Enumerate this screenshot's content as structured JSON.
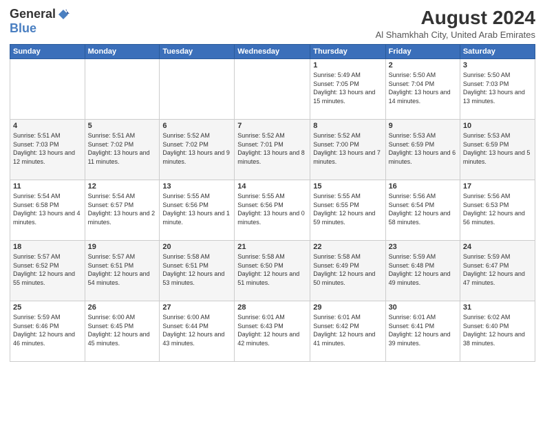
{
  "logo": {
    "general": "General",
    "blue": "Blue"
  },
  "title": "August 2024",
  "subtitle": "Al Shamkhah City, United Arab Emirates",
  "header_days": [
    "Sunday",
    "Monday",
    "Tuesday",
    "Wednesday",
    "Thursday",
    "Friday",
    "Saturday"
  ],
  "weeks": [
    [
      {
        "day": "",
        "info": ""
      },
      {
        "day": "",
        "info": ""
      },
      {
        "day": "",
        "info": ""
      },
      {
        "day": "",
        "info": ""
      },
      {
        "day": "1",
        "info": "Sunrise: 5:49 AM\nSunset: 7:05 PM\nDaylight: 13 hours\nand 15 minutes."
      },
      {
        "day": "2",
        "info": "Sunrise: 5:50 AM\nSunset: 7:04 PM\nDaylight: 13 hours\nand 14 minutes."
      },
      {
        "day": "3",
        "info": "Sunrise: 5:50 AM\nSunset: 7:03 PM\nDaylight: 13 hours\nand 13 minutes."
      }
    ],
    [
      {
        "day": "4",
        "info": "Sunrise: 5:51 AM\nSunset: 7:03 PM\nDaylight: 13 hours\nand 12 minutes."
      },
      {
        "day": "5",
        "info": "Sunrise: 5:51 AM\nSunset: 7:02 PM\nDaylight: 13 hours\nand 11 minutes."
      },
      {
        "day": "6",
        "info": "Sunrise: 5:52 AM\nSunset: 7:02 PM\nDaylight: 13 hours\nand 9 minutes."
      },
      {
        "day": "7",
        "info": "Sunrise: 5:52 AM\nSunset: 7:01 PM\nDaylight: 13 hours\nand 8 minutes."
      },
      {
        "day": "8",
        "info": "Sunrise: 5:52 AM\nSunset: 7:00 PM\nDaylight: 13 hours\nand 7 minutes."
      },
      {
        "day": "9",
        "info": "Sunrise: 5:53 AM\nSunset: 6:59 PM\nDaylight: 13 hours\nand 6 minutes."
      },
      {
        "day": "10",
        "info": "Sunrise: 5:53 AM\nSunset: 6:59 PM\nDaylight: 13 hours\nand 5 minutes."
      }
    ],
    [
      {
        "day": "11",
        "info": "Sunrise: 5:54 AM\nSunset: 6:58 PM\nDaylight: 13 hours\nand 4 minutes."
      },
      {
        "day": "12",
        "info": "Sunrise: 5:54 AM\nSunset: 6:57 PM\nDaylight: 13 hours\nand 2 minutes."
      },
      {
        "day": "13",
        "info": "Sunrise: 5:55 AM\nSunset: 6:56 PM\nDaylight: 13 hours\nand 1 minute."
      },
      {
        "day": "14",
        "info": "Sunrise: 5:55 AM\nSunset: 6:56 PM\nDaylight: 13 hours\nand 0 minutes."
      },
      {
        "day": "15",
        "info": "Sunrise: 5:55 AM\nSunset: 6:55 PM\nDaylight: 12 hours\nand 59 minutes."
      },
      {
        "day": "16",
        "info": "Sunrise: 5:56 AM\nSunset: 6:54 PM\nDaylight: 12 hours\nand 58 minutes."
      },
      {
        "day": "17",
        "info": "Sunrise: 5:56 AM\nSunset: 6:53 PM\nDaylight: 12 hours\nand 56 minutes."
      }
    ],
    [
      {
        "day": "18",
        "info": "Sunrise: 5:57 AM\nSunset: 6:52 PM\nDaylight: 12 hours\nand 55 minutes."
      },
      {
        "day": "19",
        "info": "Sunrise: 5:57 AM\nSunset: 6:51 PM\nDaylight: 12 hours\nand 54 minutes."
      },
      {
        "day": "20",
        "info": "Sunrise: 5:58 AM\nSunset: 6:51 PM\nDaylight: 12 hours\nand 53 minutes."
      },
      {
        "day": "21",
        "info": "Sunrise: 5:58 AM\nSunset: 6:50 PM\nDaylight: 12 hours\nand 51 minutes."
      },
      {
        "day": "22",
        "info": "Sunrise: 5:58 AM\nSunset: 6:49 PM\nDaylight: 12 hours\nand 50 minutes."
      },
      {
        "day": "23",
        "info": "Sunrise: 5:59 AM\nSunset: 6:48 PM\nDaylight: 12 hours\nand 49 minutes."
      },
      {
        "day": "24",
        "info": "Sunrise: 5:59 AM\nSunset: 6:47 PM\nDaylight: 12 hours\nand 47 minutes."
      }
    ],
    [
      {
        "day": "25",
        "info": "Sunrise: 5:59 AM\nSunset: 6:46 PM\nDaylight: 12 hours\nand 46 minutes."
      },
      {
        "day": "26",
        "info": "Sunrise: 6:00 AM\nSunset: 6:45 PM\nDaylight: 12 hours\nand 45 minutes."
      },
      {
        "day": "27",
        "info": "Sunrise: 6:00 AM\nSunset: 6:44 PM\nDaylight: 12 hours\nand 43 minutes."
      },
      {
        "day": "28",
        "info": "Sunrise: 6:01 AM\nSunset: 6:43 PM\nDaylight: 12 hours\nand 42 minutes."
      },
      {
        "day": "29",
        "info": "Sunrise: 6:01 AM\nSunset: 6:42 PM\nDaylight: 12 hours\nand 41 minutes."
      },
      {
        "day": "30",
        "info": "Sunrise: 6:01 AM\nSunset: 6:41 PM\nDaylight: 12 hours\nand 39 minutes."
      },
      {
        "day": "31",
        "info": "Sunrise: 6:02 AM\nSunset: 6:40 PM\nDaylight: 12 hours\nand 38 minutes."
      }
    ]
  ]
}
